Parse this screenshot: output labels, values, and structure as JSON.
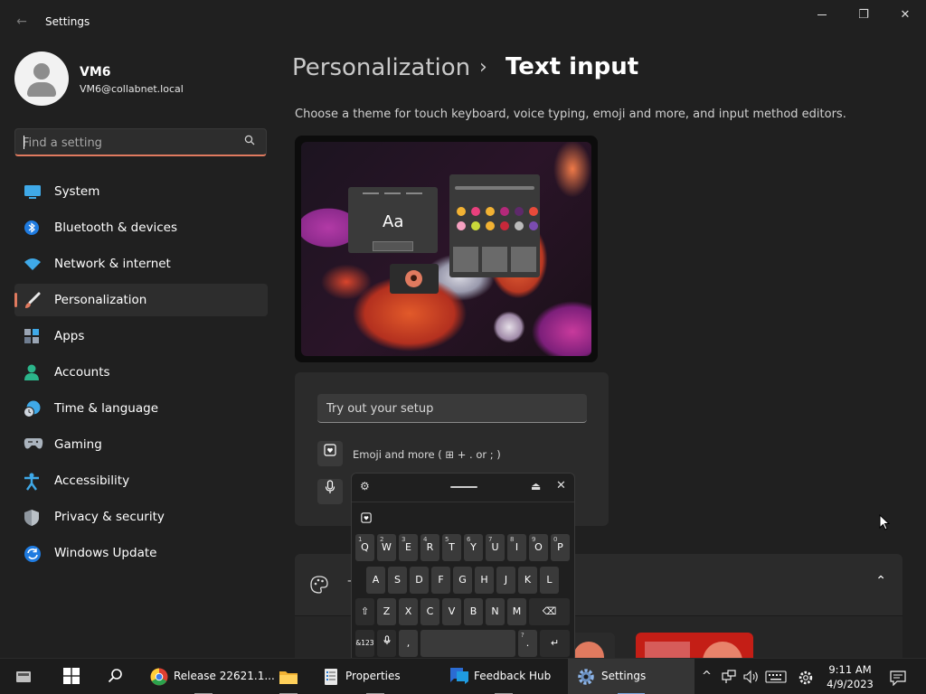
{
  "window": {
    "title": "Settings",
    "back_glyph": "←",
    "minimize_glyph": "—",
    "restore_glyph": "❐",
    "close_glyph": "✕"
  },
  "profile": {
    "name": "VM6",
    "email": "VM6@collabnet.local"
  },
  "search": {
    "placeholder": "Find a setting",
    "icon": "search-icon"
  },
  "nav": {
    "items": [
      {
        "label": "System",
        "icon": "system-icon",
        "active": false
      },
      {
        "label": "Bluetooth & devices",
        "icon": "bluetooth-icon",
        "active": false
      },
      {
        "label": "Network & internet",
        "icon": "wifi-icon",
        "active": false
      },
      {
        "label": "Personalization",
        "icon": "brush-icon",
        "active": true
      },
      {
        "label": "Apps",
        "icon": "apps-icon",
        "active": false
      },
      {
        "label": "Accounts",
        "icon": "accounts-icon",
        "active": false
      },
      {
        "label": "Time & language",
        "icon": "globe-clock-icon",
        "active": false
      },
      {
        "label": "Gaming",
        "icon": "gamepad-icon",
        "active": false
      },
      {
        "label": "Accessibility",
        "icon": "accessibility-icon",
        "active": false
      },
      {
        "label": "Privacy & security",
        "icon": "shield-icon",
        "active": false
      },
      {
        "label": "Windows Update",
        "icon": "update-icon",
        "active": false
      }
    ]
  },
  "main": {
    "breadcrumb_parent": "Personalization",
    "breadcrumb_sep": "›",
    "breadcrumb_current": "Text input",
    "subtitle": "Choose a theme for touch keyboard, voice typing, emoji and more, and input method editors.",
    "preview_sample": "Aa",
    "try_placeholder": "Try out your setup",
    "emoji_hint": "Emoji and more ( ⊞ + . or ; )",
    "dash": "-",
    "expand_glyph": "⌃"
  },
  "keyboard": {
    "row1": [
      {
        "k": "Q",
        "n": "1"
      },
      {
        "k": "W",
        "n": "2"
      },
      {
        "k": "E",
        "n": "3"
      },
      {
        "k": "R",
        "n": "4"
      },
      {
        "k": "T",
        "n": "5"
      },
      {
        "k": "Y",
        "n": "6"
      },
      {
        "k": "U",
        "n": "7"
      },
      {
        "k": "I",
        "n": "8"
      },
      {
        "k": "O",
        "n": "9"
      },
      {
        "k": "P",
        "n": "0"
      }
    ],
    "row2": [
      "A",
      "S",
      "D",
      "F",
      "G",
      "H",
      "J",
      "K",
      "L"
    ],
    "row3": [
      "⇧",
      "Z",
      "X",
      "C",
      "V",
      "B",
      "N",
      "M",
      "⌫"
    ],
    "row4": {
      "numbers": "&123",
      "mic": "🎤",
      "comma": ",",
      "period": ".",
      "question": "?",
      "enter": "↵"
    }
  },
  "taskbar": {
    "items": [
      {
        "label": "Release 22621.1...",
        "icon": "chrome-icon"
      },
      {
        "label": "Properties",
        "icon": "properties-icon"
      },
      {
        "label": "Feedback Hub",
        "icon": "feedback-hub-icon"
      },
      {
        "label": "Settings",
        "icon": "settings-icon"
      }
    ],
    "time": "9:11 AM",
    "date": "4/9/2023"
  },
  "colors": {
    "accent": "#e07a5f",
    "background": "#202020",
    "card": "#2b2b2b"
  }
}
